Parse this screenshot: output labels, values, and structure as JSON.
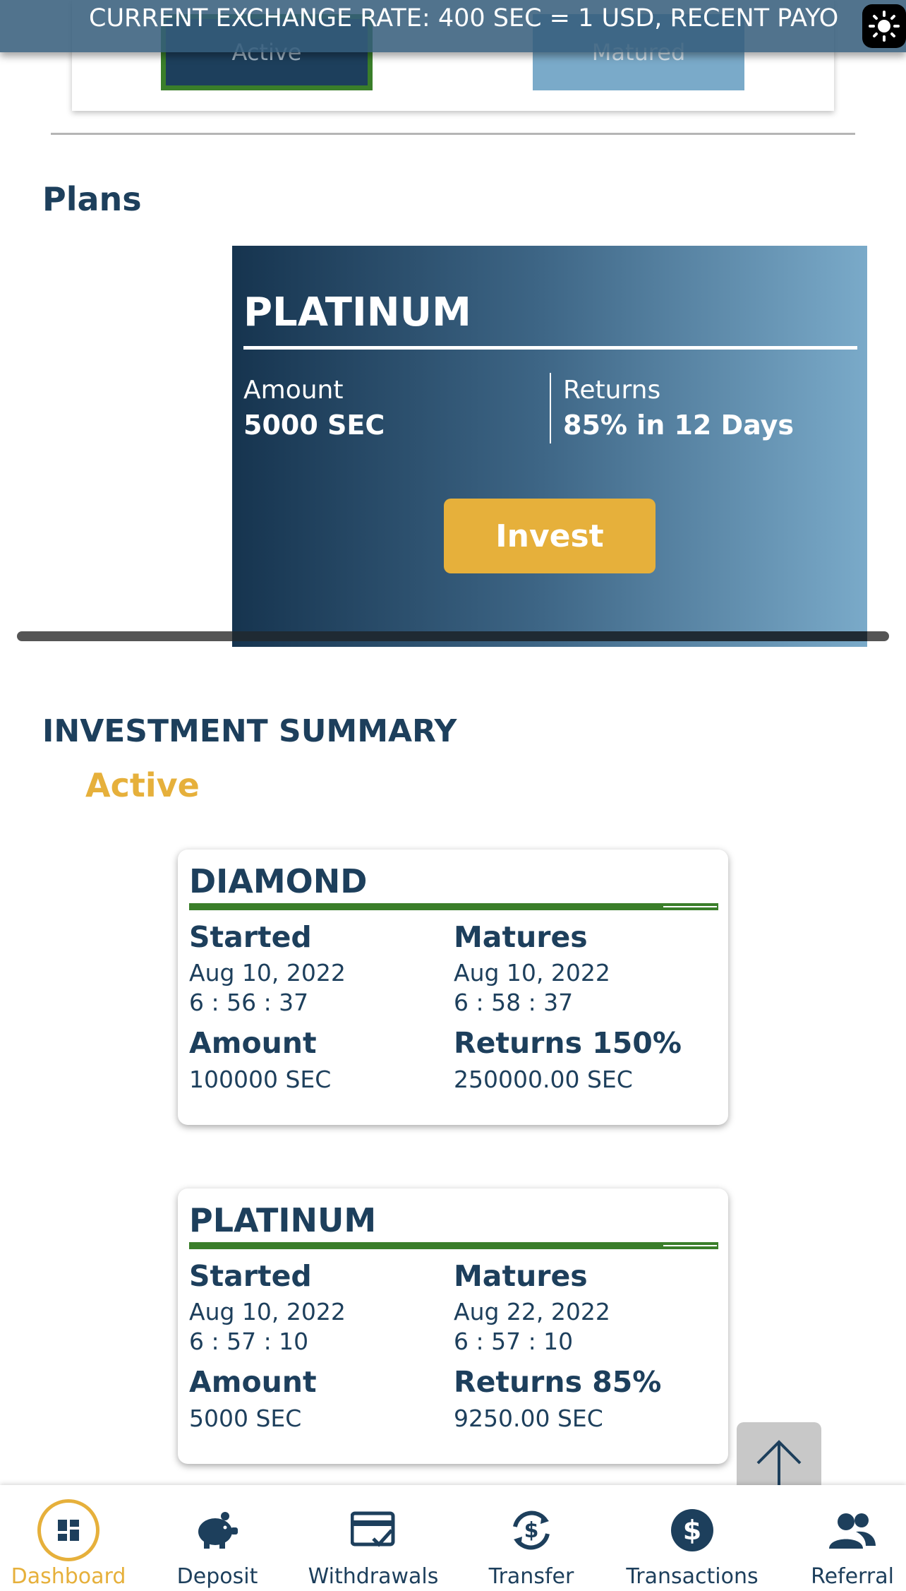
{
  "ticker": {
    "text": "CURRENT EXCHANGE RATE: 400 SEC = 1 USD, RECENT PAYO"
  },
  "toggle": {
    "active_label": "Active",
    "matured_label": "Matured"
  },
  "plans": {
    "title": "Plans",
    "card": {
      "name": "PLATINUM",
      "amount_label": "Amount",
      "amount_value": "5000 SEC",
      "returns_label": "Returns",
      "returns_value": "85% in 12 Days",
      "invest_label": "Invest"
    }
  },
  "summary": {
    "title": "INVESTMENT SUMMARY",
    "filter_label": "Active",
    "investments": [
      {
        "plan": "DIAMOND",
        "started_label": "Started",
        "started_date": "Aug 10, 2022",
        "started_time": "6 : 56 : 37",
        "matures_label": "Matures",
        "matures_date": "Aug 10, 2022",
        "matures_time": "6 : 58 : 37",
        "amount_label": "Amount",
        "amount_value": "100000 SEC",
        "returns_label": "Returns 150%",
        "returns_value": "250000.00 SEC"
      },
      {
        "plan": "PLATINUM",
        "started_label": "Started",
        "started_date": "Aug 10, 2022",
        "started_time": "6 : 57 : 10",
        "matures_label": "Matures",
        "matures_date": "Aug 22, 2022",
        "matures_time": "6 : 57 : 10",
        "amount_label": "Amount",
        "amount_value": "5000 SEC",
        "returns_label": "Returns 85%",
        "returns_value": "9250.00 SEC"
      }
    ]
  },
  "nav": {
    "items": [
      {
        "label": "Dashboard",
        "icon": "dashboard-icon",
        "active": true
      },
      {
        "label": "Deposit",
        "icon": "piggy-bank-icon"
      },
      {
        "label": "Withdrawals",
        "icon": "card-check-icon"
      },
      {
        "label": "Transfer",
        "icon": "exchange-icon"
      },
      {
        "label": "Transactions",
        "icon": "dollar-icon"
      },
      {
        "label": "Referral",
        "icon": "users-icon"
      }
    ]
  },
  "colors": {
    "navy": "#1d3f5c",
    "gold": "#e6b03b",
    "green": "#3a7e2a",
    "light_blue": "#7aaac9"
  }
}
